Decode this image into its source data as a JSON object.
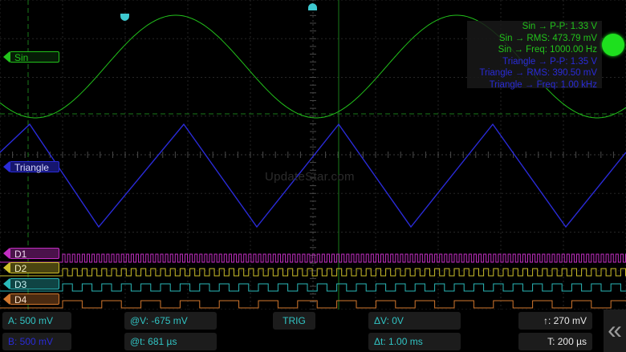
{
  "channels": {
    "sin": {
      "label": "Sin",
      "color": "#22c21b"
    },
    "triangle": {
      "label": "Triangle",
      "color": "#2a2bd8"
    },
    "d1": {
      "label": "D1",
      "color": "#c22ec2"
    },
    "d2": {
      "label": "D2",
      "color": "#cdbf2a"
    },
    "d3": {
      "label": "D3",
      "color": "#2ab9b9"
    },
    "d4": {
      "label": "D4",
      "color": "#d2772e"
    }
  },
  "measurements": [
    {
      "text": "Sin → P-P: 1.33 V",
      "color": "#22c21b"
    },
    {
      "text": "Sin → RMS: 473.79 mV",
      "color": "#22c21b"
    },
    {
      "text": "Sin → Freq: 1000.00 Hz",
      "color": "#22c21b"
    },
    {
      "text": "Triangle → P-P: 1.35 V",
      "color": "#2a2bd8"
    },
    {
      "text": "Triangle → RMS: 390.50 mV",
      "color": "#2a2bd8"
    },
    {
      "text": "Triangle → Freq: 1.00 kHz",
      "color": "#2a2bd8"
    }
  ],
  "watermark": "UpdateStar.com",
  "bottom_bar": {
    "a_scale": "A: 500 mV",
    "b_scale": "B: 500 mV",
    "at_v": "@V: -675 mV",
    "at_t": "@t: 681 µs",
    "trig": "TRIG",
    "delta_v": "ΔV: 0V",
    "delta_t": "Δt: 1.00 ms",
    "trigger_level": "↑: 270 mV",
    "timebase": "T: 200 µs",
    "collapse": "«"
  },
  "colors": {
    "cursor": "#1a7a1a",
    "trigger_marker": "#3ec9d0",
    "status_indicator": "#1ee01e"
  },
  "icons": {
    "trigger_marker": "teardrop-marker",
    "collapse": "double-chevron-left-icon"
  }
}
